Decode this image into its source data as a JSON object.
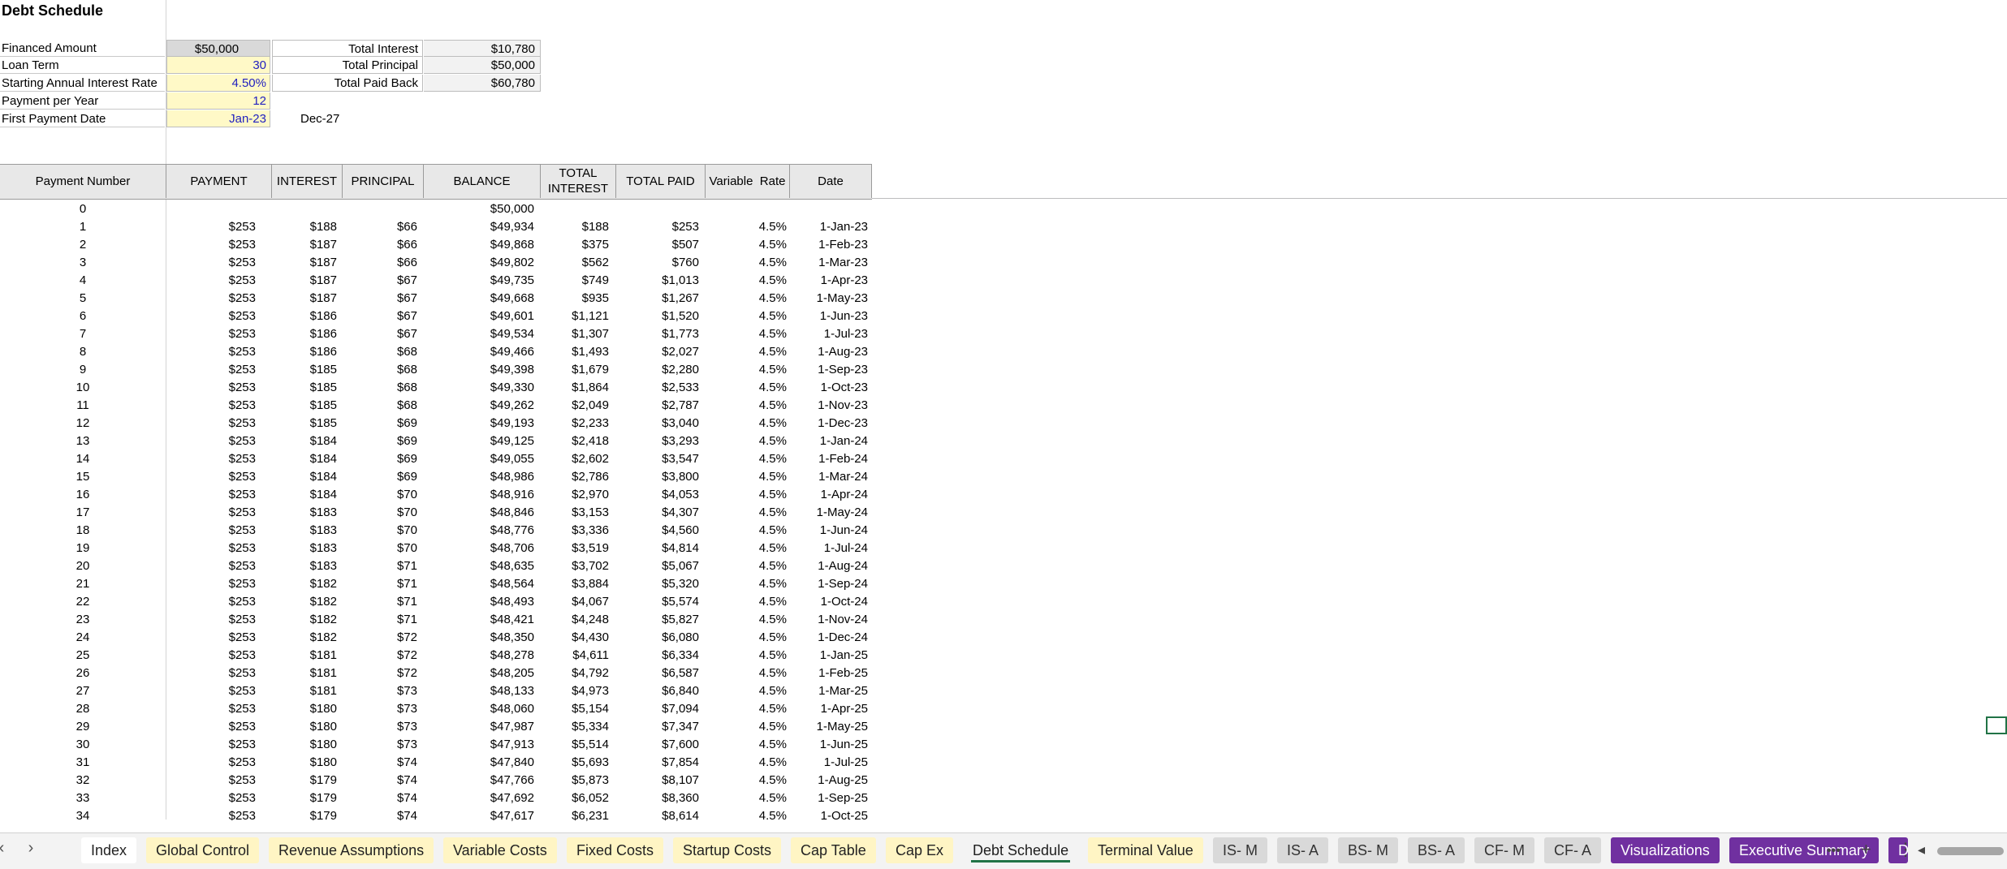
{
  "sheet_title": "Debt Schedule",
  "params": [
    {
      "label": "Financed Amount",
      "value": "$50,000",
      "kind": "calc"
    },
    {
      "label": "Loan Term",
      "value": "30",
      "kind": "input"
    },
    {
      "label": "Starting Annual Interest Rate",
      "value": "4.50%",
      "kind": "input"
    },
    {
      "label": "Payment per Year",
      "value": "12",
      "kind": "input"
    },
    {
      "label": "First Payment Date",
      "value": "Jan-23",
      "kind": "input"
    }
  ],
  "end_date": "Dec-27",
  "totals": [
    {
      "label": "Total Interest",
      "value": "$10,780"
    },
    {
      "label": "Total Principal",
      "value": "$50,000"
    },
    {
      "label": "Total Paid Back",
      "value": "$60,780"
    }
  ],
  "table": {
    "headers": [
      "Payment Number",
      "PAYMENT",
      "INTEREST",
      "PRINCIPAL",
      "BALANCE",
      "TOTAL INTEREST",
      "TOTAL PAID",
      "Variable  Rate",
      "Date"
    ],
    "rows": [
      [
        "0",
        "",
        "",
        "",
        "$50,000",
        "",
        "",
        "",
        ""
      ],
      [
        "1",
        "$253",
        "$188",
        "$66",
        "$49,934",
        "$188",
        "$253",
        "4.5%",
        "1-Jan-23"
      ],
      [
        "2",
        "$253",
        "$187",
        "$66",
        "$49,868",
        "$375",
        "$507",
        "4.5%",
        "1-Feb-23"
      ],
      [
        "3",
        "$253",
        "$187",
        "$66",
        "$49,802",
        "$562",
        "$760",
        "4.5%",
        "1-Mar-23"
      ],
      [
        "4",
        "$253",
        "$187",
        "$67",
        "$49,735",
        "$749",
        "$1,013",
        "4.5%",
        "1-Apr-23"
      ],
      [
        "5",
        "$253",
        "$187",
        "$67",
        "$49,668",
        "$935",
        "$1,267",
        "4.5%",
        "1-May-23"
      ],
      [
        "6",
        "$253",
        "$186",
        "$67",
        "$49,601",
        "$1,121",
        "$1,520",
        "4.5%",
        "1-Jun-23"
      ],
      [
        "7",
        "$253",
        "$186",
        "$67",
        "$49,534",
        "$1,307",
        "$1,773",
        "4.5%",
        "1-Jul-23"
      ],
      [
        "8",
        "$253",
        "$186",
        "$68",
        "$49,466",
        "$1,493",
        "$2,027",
        "4.5%",
        "1-Aug-23"
      ],
      [
        "9",
        "$253",
        "$185",
        "$68",
        "$49,398",
        "$1,679",
        "$2,280",
        "4.5%",
        "1-Sep-23"
      ],
      [
        "10",
        "$253",
        "$185",
        "$68",
        "$49,330",
        "$1,864",
        "$2,533",
        "4.5%",
        "1-Oct-23"
      ],
      [
        "11",
        "$253",
        "$185",
        "$68",
        "$49,262",
        "$2,049",
        "$2,787",
        "4.5%",
        "1-Nov-23"
      ],
      [
        "12",
        "$253",
        "$185",
        "$69",
        "$49,193",
        "$2,233",
        "$3,040",
        "4.5%",
        "1-Dec-23"
      ],
      [
        "13",
        "$253",
        "$184",
        "$69",
        "$49,125",
        "$2,418",
        "$3,293",
        "4.5%",
        "1-Jan-24"
      ],
      [
        "14",
        "$253",
        "$184",
        "$69",
        "$49,055",
        "$2,602",
        "$3,547",
        "4.5%",
        "1-Feb-24"
      ],
      [
        "15",
        "$253",
        "$184",
        "$69",
        "$48,986",
        "$2,786",
        "$3,800",
        "4.5%",
        "1-Mar-24"
      ],
      [
        "16",
        "$253",
        "$184",
        "$70",
        "$48,916",
        "$2,970",
        "$4,053",
        "4.5%",
        "1-Apr-24"
      ],
      [
        "17",
        "$253",
        "$183",
        "$70",
        "$48,846",
        "$3,153",
        "$4,307",
        "4.5%",
        "1-May-24"
      ],
      [
        "18",
        "$253",
        "$183",
        "$70",
        "$48,776",
        "$3,336",
        "$4,560",
        "4.5%",
        "1-Jun-24"
      ],
      [
        "19",
        "$253",
        "$183",
        "$70",
        "$48,706",
        "$3,519",
        "$4,814",
        "4.5%",
        "1-Jul-24"
      ],
      [
        "20",
        "$253",
        "$183",
        "$71",
        "$48,635",
        "$3,702",
        "$5,067",
        "4.5%",
        "1-Aug-24"
      ],
      [
        "21",
        "$253",
        "$182",
        "$71",
        "$48,564",
        "$3,884",
        "$5,320",
        "4.5%",
        "1-Sep-24"
      ],
      [
        "22",
        "$253",
        "$182",
        "$71",
        "$48,493",
        "$4,067",
        "$5,574",
        "4.5%",
        "1-Oct-24"
      ],
      [
        "23",
        "$253",
        "$182",
        "$71",
        "$48,421",
        "$4,248",
        "$5,827",
        "4.5%",
        "1-Nov-24"
      ],
      [
        "24",
        "$253",
        "$182",
        "$72",
        "$48,350",
        "$4,430",
        "$6,080",
        "4.5%",
        "1-Dec-24"
      ],
      [
        "25",
        "$253",
        "$181",
        "$72",
        "$48,278",
        "$4,611",
        "$6,334",
        "4.5%",
        "1-Jan-25"
      ],
      [
        "26",
        "$253",
        "$181",
        "$72",
        "$48,205",
        "$4,792",
        "$6,587",
        "4.5%",
        "1-Feb-25"
      ],
      [
        "27",
        "$253",
        "$181",
        "$73",
        "$48,133",
        "$4,973",
        "$6,840",
        "4.5%",
        "1-Mar-25"
      ],
      [
        "28",
        "$253",
        "$180",
        "$73",
        "$48,060",
        "$5,154",
        "$7,094",
        "4.5%",
        "1-Apr-25"
      ],
      [
        "29",
        "$253",
        "$180",
        "$73",
        "$47,987",
        "$5,334",
        "$7,347",
        "4.5%",
        "1-May-25"
      ],
      [
        "30",
        "$253",
        "$180",
        "$73",
        "$47,913",
        "$5,514",
        "$7,600",
        "4.5%",
        "1-Jun-25"
      ],
      [
        "31",
        "$253",
        "$180",
        "$74",
        "$47,840",
        "$5,693",
        "$7,854",
        "4.5%",
        "1-Jul-25"
      ],
      [
        "32",
        "$253",
        "$179",
        "$74",
        "$47,766",
        "$5,873",
        "$8,107",
        "4.5%",
        "1-Aug-25"
      ],
      [
        "33",
        "$253",
        "$179",
        "$74",
        "$47,692",
        "$6,052",
        "$8,360",
        "4.5%",
        "1-Sep-25"
      ],
      [
        "34",
        "$253",
        "$179",
        "$74",
        "$47,617",
        "$6,231",
        "$8,614",
        "4.5%",
        "1-Oct-25"
      ]
    ]
  },
  "tabs": [
    {
      "label": "Index",
      "style": "plain"
    },
    {
      "label": "Global Control",
      "style": "yellow"
    },
    {
      "label": "Revenue Assumptions",
      "style": "yellow"
    },
    {
      "label": "Variable Costs",
      "style": "yellow"
    },
    {
      "label": "Fixed Costs",
      "style": "yellow"
    },
    {
      "label": "Startup Costs",
      "style": "yellow"
    },
    {
      "label": "Cap Table",
      "style": "yellow"
    },
    {
      "label": "Cap Ex",
      "style": "yellow"
    },
    {
      "label": "Debt Schedule",
      "style": "active"
    },
    {
      "label": "Terminal Value",
      "style": "yellow"
    },
    {
      "label": "IS- M",
      "style": "grey"
    },
    {
      "label": "IS- A",
      "style": "grey"
    },
    {
      "label": "BS- M",
      "style": "grey"
    },
    {
      "label": "BS- A",
      "style": "grey"
    },
    {
      "label": "CF- M",
      "style": "grey"
    },
    {
      "label": "CF- A",
      "style": "grey"
    },
    {
      "label": "Visualizations",
      "style": "purple"
    },
    {
      "label": "Executive Summary",
      "style": "purple"
    },
    {
      "label": "Dist",
      "style": "purple"
    }
  ],
  "tab_controls": {
    "prev": "‹",
    "next": "›",
    "more": "•••",
    "add": "+",
    "options": "⋮",
    "scroll_left": "◂"
  }
}
